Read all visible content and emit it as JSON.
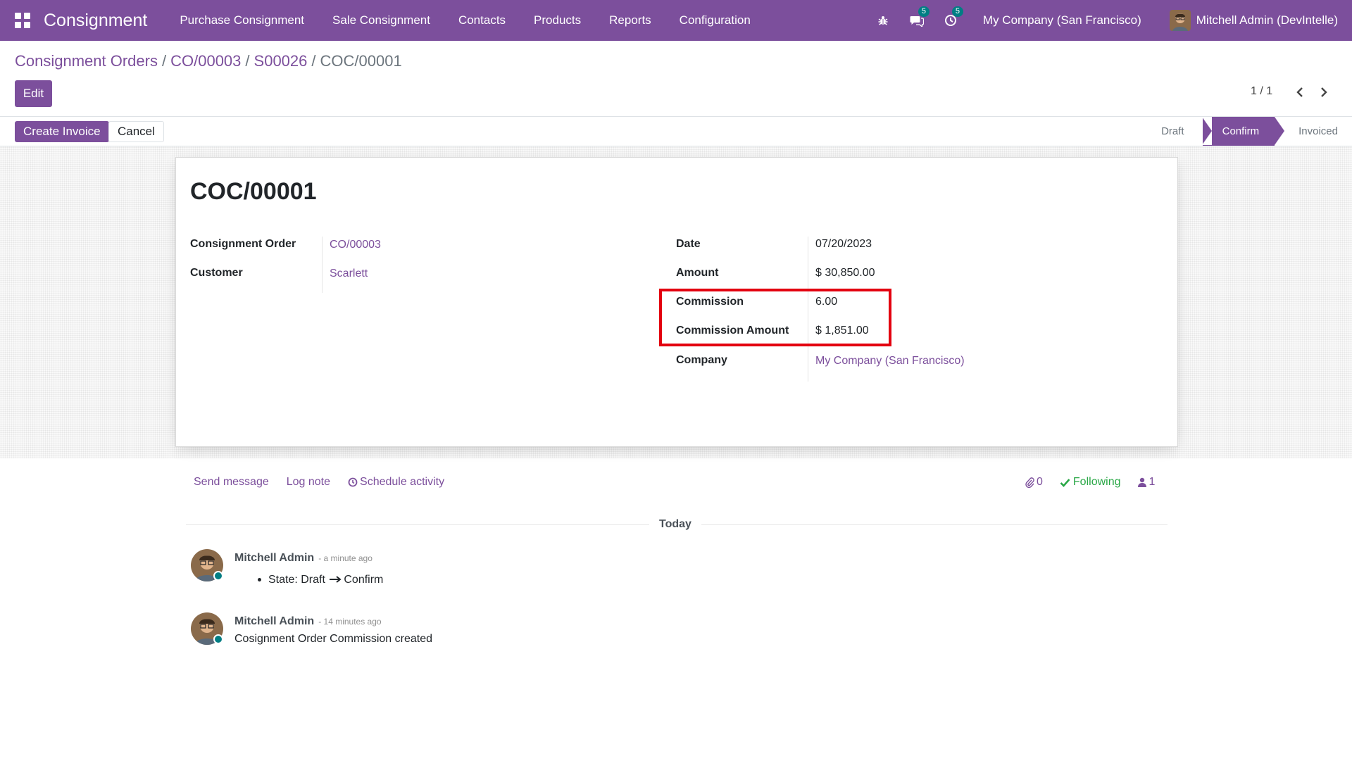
{
  "navbar": {
    "app_name": "Consignment",
    "menu": [
      "Purchase Consignment",
      "Sale Consignment",
      "Contacts",
      "Products",
      "Reports",
      "Configuration"
    ],
    "messages_badge": "5",
    "activities_badge": "5",
    "company": "My Company (San Francisco)",
    "user": "Mitchell Admin (DevIntelle)",
    "color": "#7c4f9c"
  },
  "breadcrumb": {
    "items": [
      "Consignment Orders",
      "CO/00003",
      "S00026"
    ],
    "current": "COC/00001",
    "separator": "/"
  },
  "control": {
    "edit_label": "Edit",
    "pager": "1 / 1"
  },
  "statusbar": {
    "create_invoice_label": "Create Invoice",
    "cancel_label": "Cancel",
    "stages": [
      "Draft",
      "Confirm",
      "Invoiced"
    ],
    "active_stage": "Confirm"
  },
  "form": {
    "title": "COC/00001",
    "left": [
      {
        "label": "Consignment Order",
        "value": "CO/00003"
      },
      {
        "label": "Customer",
        "value": "Scarlett"
      }
    ],
    "right": [
      {
        "label": "Date",
        "value": "07/20/2023"
      },
      {
        "label": "Amount",
        "value": "$ 30,850.00"
      },
      {
        "label": "Commission",
        "value": "6.00"
      },
      {
        "label": "Commission Amount",
        "value": "$ 1,851.00"
      },
      {
        "label": "Company",
        "value": "My Company (San Francisco)"
      }
    ],
    "highlight_color": "#e3000f"
  },
  "chatter": {
    "send_message": "Send message",
    "log_note": "Log note",
    "schedule_activity": "Schedule activity",
    "attachments": "0",
    "following": "Following",
    "followers": "1",
    "day": "Today",
    "messages": [
      {
        "author": "Mitchell Admin",
        "time": "- a minute ago",
        "body_from": "State: Draft",
        "body_to": "Confirm"
      },
      {
        "author": "Mitchell Admin",
        "time": "- 14 minutes ago",
        "body": "Cosignment Order Commission created"
      }
    ]
  }
}
